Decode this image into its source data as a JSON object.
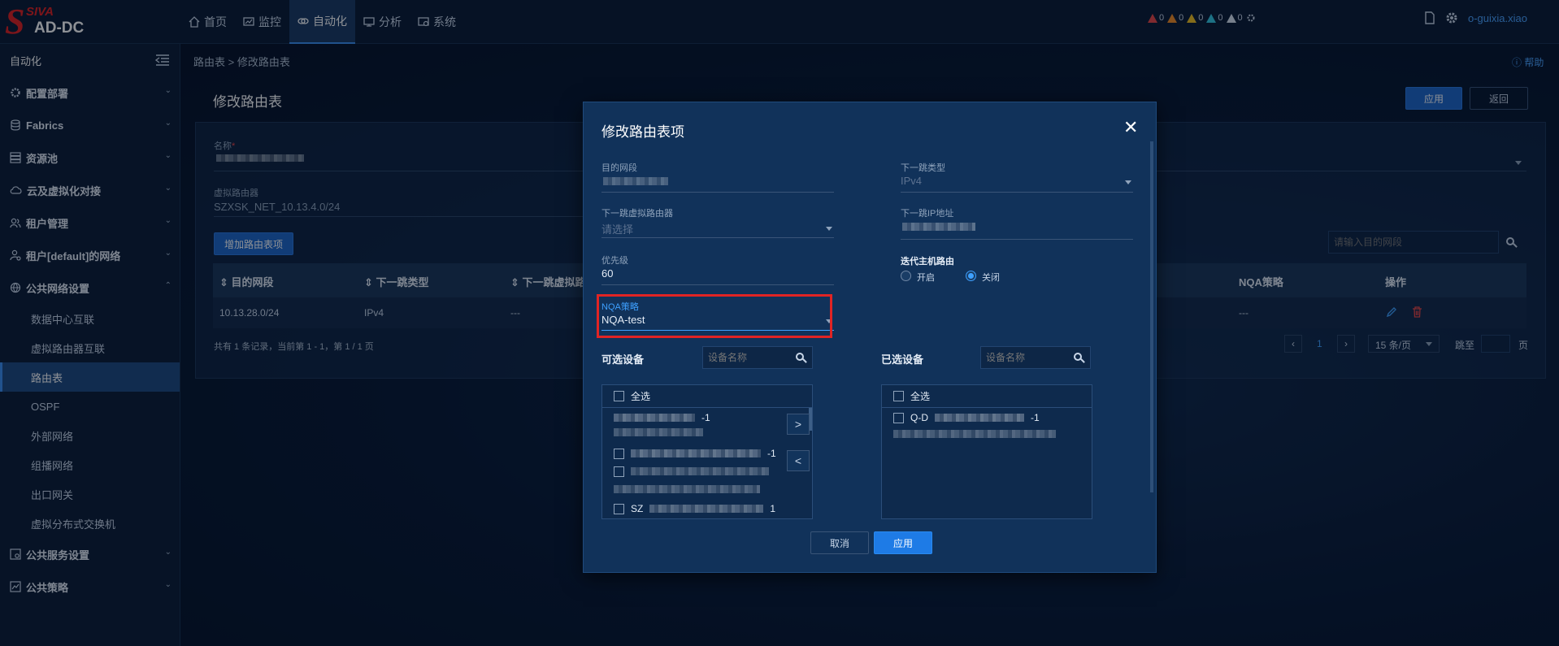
{
  "topbar": {
    "brand": "SIVA",
    "logo_letter": "S",
    "product": "AD-DC",
    "nav": [
      {
        "label": "首页",
        "icon": "home-icon"
      },
      {
        "label": "监控",
        "icon": "monitor-icon"
      },
      {
        "label": "自动化",
        "icon": "automation-icon",
        "active": true
      },
      {
        "label": "分析",
        "icon": "chart-icon"
      },
      {
        "label": "系统",
        "icon": "system-icon"
      }
    ],
    "alarms": [
      "0",
      "0",
      "0",
      "0",
      "0"
    ],
    "user": "o-guixia.xiao"
  },
  "sidebar": {
    "title": "自动化",
    "groups": [
      {
        "label": "配置部署"
      },
      {
        "label": "Fabrics"
      },
      {
        "label": "资源池"
      },
      {
        "label": "云及虚拟化对接"
      },
      {
        "label": "租户管理"
      },
      {
        "label": "租户[default]的网络"
      },
      {
        "label": "公共网络设置"
      }
    ],
    "subitems": [
      "数据中心互联",
      "虚拟路由器互联",
      "路由表",
      "OSPF",
      "外部网络",
      "组播网络",
      "出口网关",
      "虚拟分布式交换机"
    ],
    "groups_after": [
      {
        "label": "公共服务设置"
      },
      {
        "label": "公共策略"
      }
    ]
  },
  "page": {
    "breadcrumb": "路由表 > 修改路由表",
    "help": "帮助",
    "title": "修改路由表",
    "apply": "应用",
    "back": "返回",
    "name_label": "名称",
    "name_required": "*",
    "vrouter_label": "虚拟路由器",
    "vrouter_value": "SZXSK_NET_10.13.4.0/24",
    "add_button": "增加路由表项",
    "search_placeholder": "请输入目的网段",
    "table": {
      "headers": [
        "目的网段",
        "下一跳类型",
        "下一跳虚拟路",
        "NQA策略",
        "操作"
      ],
      "row": [
        "10.13.28.0/24",
        "IPv4",
        "---",
        "---"
      ]
    },
    "footer": "共有 1 条记录，当前第 1 - 1，第 1 / 1 页",
    "pagination": {
      "current": "1",
      "page_size": "15 条/页",
      "jump": "跳至",
      "page_unit": "页"
    }
  },
  "modal": {
    "title": "修改路由表项",
    "dest_label": "目的网段",
    "nexthop_type_label": "下一跳类型",
    "nexthop_type_value": "IPv4",
    "nexthop_vrouter_label": "下一跳虚拟路由器",
    "nexthop_vrouter_placeholder": "请选择",
    "nexthop_ip_label": "下一跳IP地址",
    "priority_label": "优先级",
    "priority_value": "60",
    "iter_label": "迭代主机路由",
    "iter_on": "开启",
    "iter_off": "关闭",
    "nqa_label": "NQA策略",
    "nqa_value": "NQA-test",
    "available_label": "可选设备",
    "selected_label": "已选设备",
    "device_placeholder": "设备名称",
    "select_all": "全选",
    "available_rows": [
      "-1",
      "",
      "01",
      "-1",
      "",
      "",
      "SZ",
      "1"
    ],
    "selected_rows": [
      "Q-D",
      "-1"
    ],
    "to_right": ">",
    "to_left": "<",
    "cancel": "取消",
    "apply": "应用"
  },
  "colors": {
    "accent": "#1e66c8",
    "highlight": "#e02424",
    "active_text": "#3ea0ff"
  }
}
